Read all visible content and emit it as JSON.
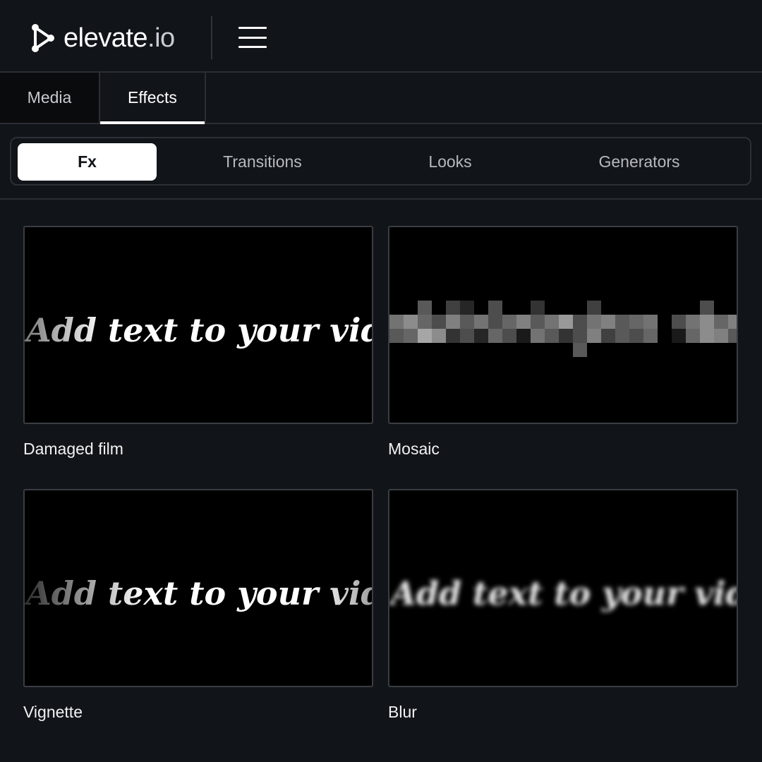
{
  "header": {
    "brand_name": "elevate",
    "brand_tld": ".io"
  },
  "main_tabs": [
    {
      "label": "Media",
      "active": false
    },
    {
      "label": "Effects",
      "active": true
    }
  ],
  "sub_tabs": [
    {
      "label": "Fx",
      "active": true
    },
    {
      "label": "Transitions",
      "active": false
    },
    {
      "label": "Looks",
      "active": false
    },
    {
      "label": "Generators",
      "active": false
    }
  ],
  "effects": [
    {
      "name": "Damaged film",
      "preview_text": "Add text to your video"
    },
    {
      "name": "Mosaic",
      "preview_text": ""
    },
    {
      "name": "Vignette",
      "preview_text": "Add text to your video"
    },
    {
      "name": "Blur",
      "preview_text": "Add text to your video"
    }
  ],
  "colors": {
    "background": "#111418",
    "accent": "#ffffff",
    "border": "#2a2e34"
  }
}
